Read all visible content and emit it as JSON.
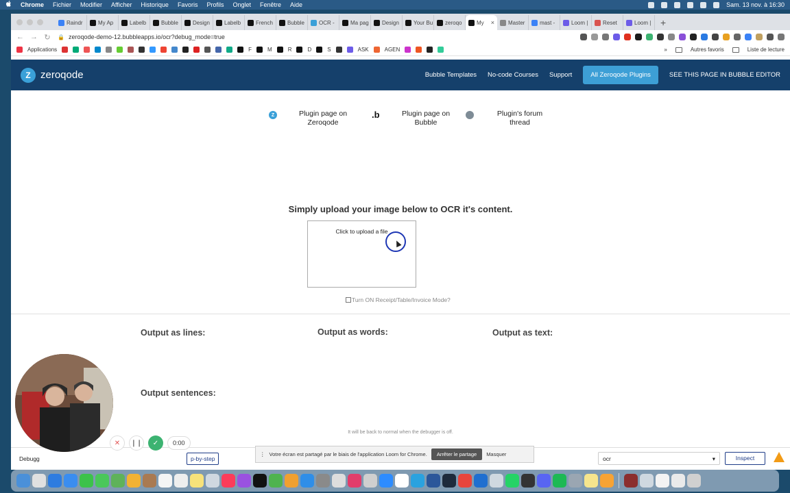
{
  "menubar": {
    "app_name": "Chrome",
    "menus": [
      "Fichier",
      "Modifier",
      "Afficher",
      "Historique",
      "Favoris",
      "Profils",
      "Onglet",
      "Fenêtre",
      "Aide"
    ],
    "clock": "Sam. 13 nov. à 16:30"
  },
  "browser": {
    "tabs": [
      {
        "label": "Raindr",
        "color": "#3b82f6"
      },
      {
        "label": "My Ap",
        "color": "#111111"
      },
      {
        "label": "Labelb",
        "color": "#111111"
      },
      {
        "label": "Bubble",
        "color": "#111111"
      },
      {
        "label": "Design",
        "color": "#111111"
      },
      {
        "label": "Labelb",
        "color": "#111111"
      },
      {
        "label": "French",
        "color": "#111111"
      },
      {
        "label": "Bubble",
        "color": "#111111"
      },
      {
        "label": "OCR -",
        "color": "#3aa0d8"
      },
      {
        "label": "Ma pag",
        "color": "#111111"
      },
      {
        "label": "Design",
        "color": "#111111"
      },
      {
        "label": "Your Bu",
        "color": "#111111"
      },
      {
        "label": "zeroqo",
        "color": "#111111"
      },
      {
        "label": "My",
        "color": "#111111",
        "active": true
      },
      {
        "label": "Master",
        "color": "#888888"
      },
      {
        "label": "mast -",
        "color": "#3b82f6"
      },
      {
        "label": "Loom |",
        "color": "#6d5ce8"
      },
      {
        "label": "Reset",
        "color": "#d9534f"
      },
      {
        "label": "Loom |",
        "color": "#6d5ce8"
      }
    ],
    "url": "zeroqode-demo-12.bubbleapps.io/ocr?debug_mode=true",
    "bookmarks_label": "Applications",
    "bookmarks": [
      "F",
      "M",
      "R",
      "D",
      "S",
      "ASK",
      "AGEN"
    ],
    "other_favorites": "Autres favoris",
    "reading_list": "Liste de lecture"
  },
  "page": {
    "logo_text": "zeroqode",
    "logo_mark": "Z",
    "nav": [
      "Bubble Templates",
      "No-code Courses",
      "Support"
    ],
    "plugins_button": "All Zeroqode Plugins",
    "editor_link": "SEE THIS PAGE IN BUBBLE EDITOR",
    "links": [
      {
        "label": "Plugin page on Zeroqode",
        "icon": "zeroqode-icon"
      },
      {
        "label": "Plugin page on Bubble",
        "icon": "bubble-icon"
      },
      {
        "label": "Plugin's forum thread",
        "icon": "forum-icon"
      }
    ],
    "upload_title": "Simply upload your image below to OCR it's content.",
    "upload_label": "Click to upload a file",
    "receipt_mode": "Turn ON Receipt/Table/Invoice Mode?",
    "outputs": {
      "lines": "Output as lines:",
      "words": "Output as words:",
      "text": "Output as text:",
      "sentences": "Output sentences:"
    },
    "debug_note": "It will be back to normal when the debugger is off."
  },
  "debugger": {
    "label": "Debugg",
    "step_button": "p-by-step",
    "select_value": "ocr",
    "inspect_button": "Inspect"
  },
  "loom": {
    "timer": "0:00",
    "share_message": "Votre écran est partagé par le biais de l'application Loom for Chrome.",
    "stop_button": "Arrêter le partage",
    "hide_button": "Masquer"
  },
  "colors": {
    "header_bg": "#15406b",
    "accent": "#3d9fd6",
    "cursor_ring": "#1d36b4"
  }
}
